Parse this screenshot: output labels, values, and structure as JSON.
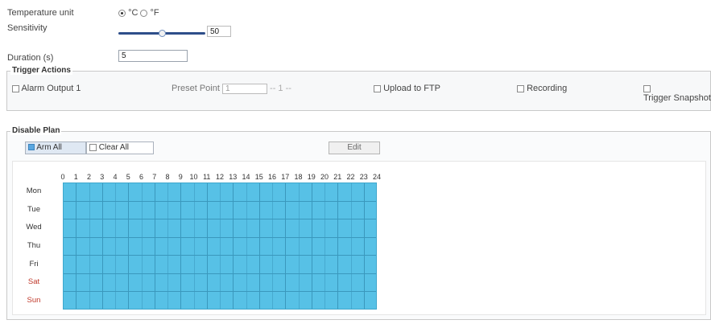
{
  "settings": {
    "temperature_unit_label": "Temperature unit",
    "unit_options": [
      "°C",
      "°F"
    ],
    "unit_selected": "°C",
    "sensitivity_label": "Sensitivity",
    "sensitivity_value": "50",
    "sensitivity_fraction": 0.5,
    "duration_label": "Duration (s)",
    "duration_value": "5"
  },
  "trigger_actions": {
    "legend": "Trigger Actions",
    "items": [
      {
        "label": "Alarm Output 1",
        "checked": false
      },
      {
        "label": "Preset Point",
        "select_value": "1",
        "extra": "-- 1 --",
        "checked": false
      },
      {
        "label": "Upload to FTP",
        "checked": false
      },
      {
        "label": "Recording",
        "checked": false
      },
      {
        "label": "Trigger Snapshot",
        "checked": false
      }
    ]
  },
  "schedule": {
    "legend": "Disable Plan",
    "tabs": [
      {
        "label": "Arm All",
        "active": true
      },
      {
        "label": "Clear All",
        "active": false
      }
    ],
    "edit_button": "Edit",
    "hours": [
      "0",
      "1",
      "2",
      "3",
      "4",
      "5",
      "6",
      "7",
      "8",
      "9",
      "10",
      "11",
      "12",
      "13",
      "14",
      "15",
      "16",
      "17",
      "18",
      "19",
      "20",
      "21",
      "22",
      "23",
      "24"
    ],
    "days": [
      {
        "label": "Mon",
        "weekend": false
      },
      {
        "label": "Tue",
        "weekend": false
      },
      {
        "label": "Wed",
        "weekend": false
      },
      {
        "label": "Thu",
        "weekend": false
      },
      {
        "label": "Fri",
        "weekend": false
      },
      {
        "label": "Sat",
        "weekend": true
      },
      {
        "label": "Sun",
        "weekend": true
      }
    ],
    "grid_color": "#57c1e6"
  }
}
